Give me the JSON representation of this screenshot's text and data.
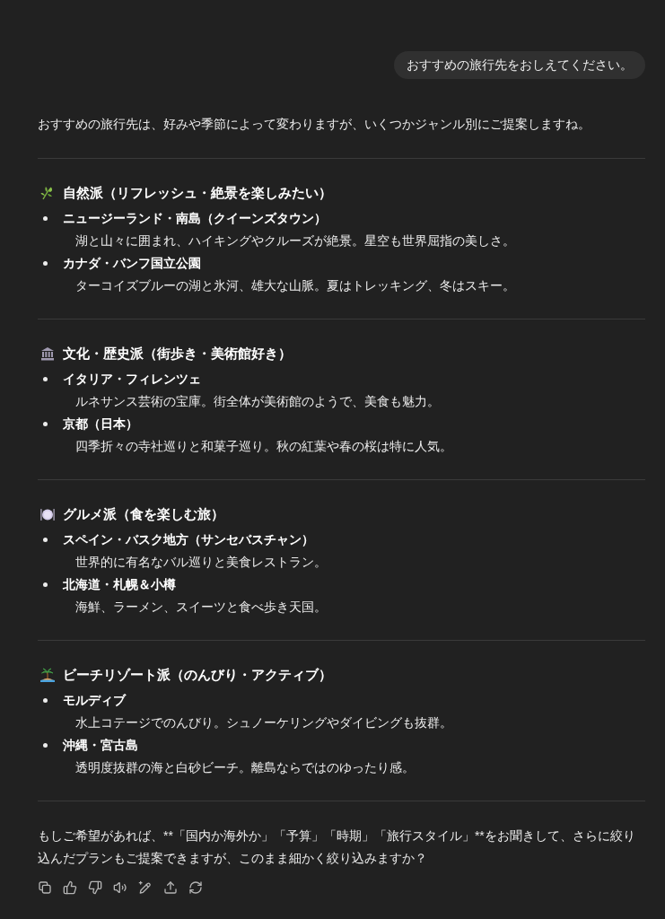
{
  "user_message": {
    "text": "おすすめの旅行先をおしえてください。"
  },
  "assistant": {
    "intro": "おすすめの旅行先は、好みや季節によって変わりますが、いくつかジャンル別にご提案しますね。",
    "sections": [
      {
        "kind": "nature",
        "title": "自然派（リフレッシュ・絶景を楽しみたい）",
        "items": [
          {
            "name": "ニュージーランド・南島（クイーンズタウン）",
            "description": "湖と山々に囲まれ、ハイキングやクルーズが絶景。星空も世界屈指の美しさ。"
          },
          {
            "name": "カナダ・バンフ国立公園",
            "description": "ターコイズブルーの湖と氷河、雄大な山脈。夏はトレッキング、冬はスキー。"
          }
        ]
      },
      {
        "kind": "culture",
        "title": "文化・歴史派（街歩き・美術館好き）",
        "items": [
          {
            "name": "イタリア・フィレンツェ",
            "description": "ルネサンス芸術の宝庫。街全体が美術館のようで、美食も魅力。"
          },
          {
            "name": "京都（日本）",
            "description": "四季折々の寺社巡りと和菓子巡り。秋の紅葉や春の桜は特に人気。"
          }
        ]
      },
      {
        "kind": "gourmet",
        "title": "グルメ派（食を楽しむ旅）",
        "items": [
          {
            "name": "スペイン・バスク地方（サンセバスチャン）",
            "description": "世界的に有名なバル巡りと美食レストラン。"
          },
          {
            "name": "北海道・札幌＆小樽",
            "description": "海鮮、ラーメン、スイーツと食べ歩き天国。"
          }
        ]
      },
      {
        "kind": "beach",
        "title": "ビーチリゾート派（のんびり・アクティブ）",
        "items": [
          {
            "name": "モルディブ",
            "description": "水上コテージでのんびり。シュノーケリングやダイビングも抜群。"
          },
          {
            "name": "沖縄・宮古島",
            "description": "透明度抜群の海と白砂ビーチ。離島ならではのゆったり感。"
          }
        ]
      }
    ],
    "closing": "もしご希望があれば、**「国内か海外か」「予算」「時期」「旅行スタイル」**をお聞きして、さらに絞り込んだプランもご提案できますが、このまま細かく絞り込みますか？"
  }
}
